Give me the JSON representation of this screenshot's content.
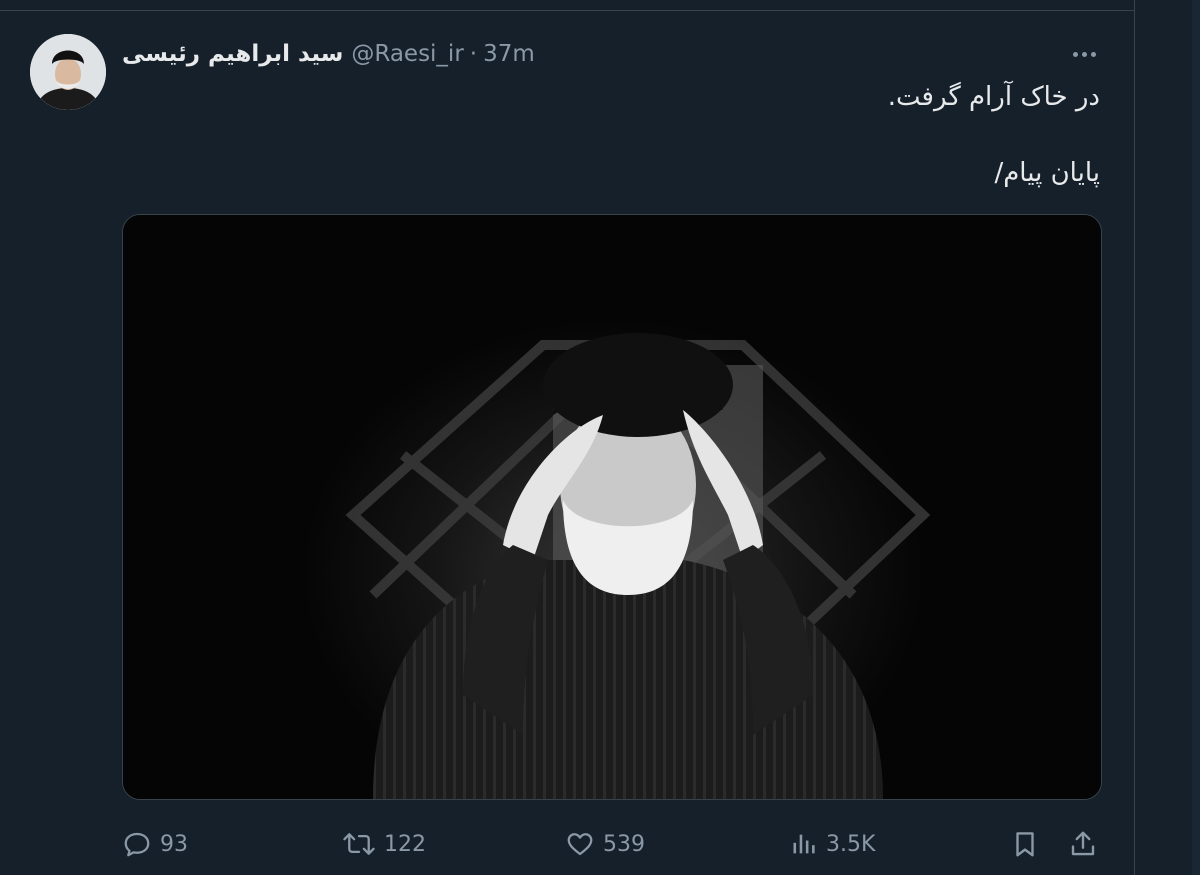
{
  "tweet": {
    "author": {
      "display_name": "سید ابراهیم رئیسی",
      "handle": "@Raesi_ir",
      "separator": "·",
      "time": "37m"
    },
    "text_lines": [
      "در خاک آرام گرفت.",
      "پایان پیام/"
    ],
    "actions": {
      "replies": "93",
      "retweets": "122",
      "likes": "539",
      "views": "3.5K"
    }
  },
  "icons": {
    "more": "more-dots-icon",
    "reply": "reply-icon",
    "retweet": "retweet-icon",
    "like": "heart-icon",
    "views": "views-icon",
    "bookmark": "bookmark-icon",
    "share": "share-icon"
  },
  "colors": {
    "background": "#15202b",
    "text_primary": "#e7e9ea",
    "text_secondary": "#8b98a5",
    "border": "#38444d"
  }
}
